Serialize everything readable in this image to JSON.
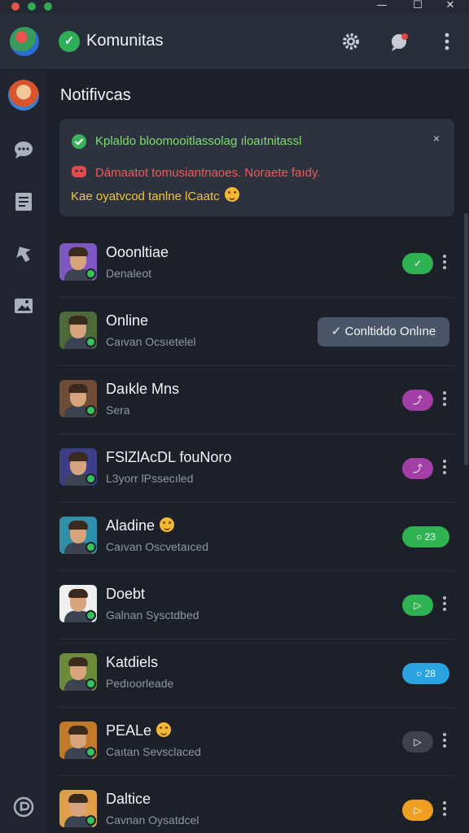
{
  "window": {
    "traffic_lights": [
      "#e8524a",
      "#35a94f",
      "#35a94f"
    ],
    "controls": [
      "—",
      "☐",
      "✕"
    ]
  },
  "header": {
    "title": "Komunitas",
    "brand_icon": "check-badge-icon",
    "brand_check": "✓",
    "actions": [
      "settings-icon",
      "new-chat-icon",
      "more-icon"
    ]
  },
  "sidebar": {
    "items": [
      "profile-avatar",
      "chat-icon",
      "document-icon",
      "pin-icon",
      "gallery-icon"
    ],
    "footer": "help-icon"
  },
  "notifications": {
    "title": "Notifivcas",
    "lines": [
      {
        "text": "Kplaldo bloomooitlassolag ıloaıtnitassl",
        "color": "#7fdc6e",
        "icon": "check-circle-icon"
      },
      {
        "text": "Dámaatot tomusiantnaoes. Noraete faıdy.",
        "color": "#ef5a5a",
        "icon": "alert-icon"
      },
      {
        "text": "Kae oyatvcod tanlne lCaatc",
        "color": "#f0c43c",
        "icon": "smile-emoji-icon"
      }
    ],
    "close": "×"
  },
  "contacts": [
    {
      "name": "Ooonltiae",
      "sub": "Denaleot",
      "action": {
        "kind": "pill",
        "color": "#2fb251",
        "glyph": "✓",
        "width": 38
      },
      "avatar_bg": "#7e57c2",
      "emoji": false
    },
    {
      "name": "Online",
      "sub": "Caıvan Ocsıetelel",
      "action": {
        "kind": "wide",
        "label": "✓ Conltiddo Onlıne"
      },
      "avatar_bg": "#4e6a3a",
      "emoji": false
    },
    {
      "name": "Daıkle Mns",
      "sub": "Sera",
      "action": {
        "kind": "pill",
        "color": "#a23fa6",
        "glyph": "⤴",
        "width": 38
      },
      "avatar_bg": "#6e4b35",
      "emoji": false
    },
    {
      "name": "FSlZlAcDL fouNoro",
      "sub": "L3yorr lPssecıled",
      "action": {
        "kind": "pill",
        "color": "#a23fa6",
        "glyph": "⤴",
        "width": 38
      },
      "avatar_bg": "#3d3f86",
      "emoji": false
    },
    {
      "name": "Aladine",
      "sub": "Caıvan Oscvetaıced",
      "action": {
        "kind": "pill",
        "color": "#2fb251",
        "glyph": "○ 23",
        "width": 58
      },
      "avatar_bg": "#2f8fa8",
      "emoji": true
    },
    {
      "name": "Doebt",
      "sub": "Galnan Sysctdbed",
      "action": {
        "kind": "pill",
        "color": "#2fb251",
        "glyph": "▷",
        "width": 38
      },
      "avatar_bg": "#f0f0f0",
      "emoji": false
    },
    {
      "name": "Katdiels",
      "sub": "Pedıoorleade",
      "action": {
        "kind": "pill",
        "color": "#2ba3e0",
        "glyph": "○ 28",
        "width": 58
      },
      "avatar_bg": "#6b8a3a",
      "emoji": false
    },
    {
      "name": "PEALe",
      "sub": "Caıtan Sevsclaced",
      "action": {
        "kind": "pill",
        "color": "#3d424c",
        "glyph": "▷",
        "width": 38
      },
      "avatar_bg": "#c07a2a",
      "emoji": true
    },
    {
      "name": "Daltice",
      "sub": "Cavnan Oysatdcel",
      "action": {
        "kind": "pill",
        "color": "#f0a020",
        "glyph": "▷",
        "width": 38
      },
      "avatar_bg": "#e0a04a",
      "emoji": false
    }
  ]
}
